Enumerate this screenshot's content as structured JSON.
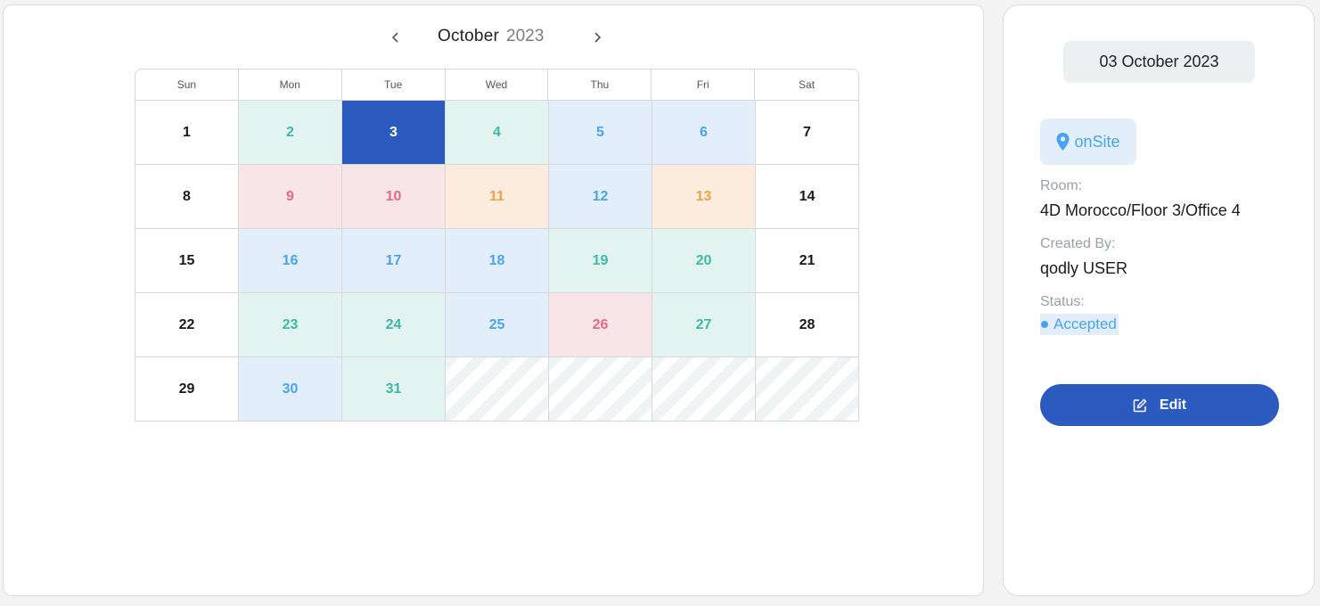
{
  "calendar": {
    "month": "October",
    "year": "2023",
    "weekdays": [
      "Sun",
      "Mon",
      "Tue",
      "Wed",
      "Thu",
      "Fri",
      "Sat"
    ],
    "days": [
      {
        "label": "1",
        "style": "white"
      },
      {
        "label": "2",
        "style": "green"
      },
      {
        "label": "3",
        "style": "selected"
      },
      {
        "label": "4",
        "style": "green"
      },
      {
        "label": "5",
        "style": "blue"
      },
      {
        "label": "6",
        "style": "blue"
      },
      {
        "label": "7",
        "style": "white"
      },
      {
        "label": "8",
        "style": "white"
      },
      {
        "label": "9",
        "style": "pink"
      },
      {
        "label": "10",
        "style": "pink"
      },
      {
        "label": "11",
        "style": "orange"
      },
      {
        "label": "12",
        "style": "blue"
      },
      {
        "label": "13",
        "style": "orange"
      },
      {
        "label": "14",
        "style": "white"
      },
      {
        "label": "15",
        "style": "white"
      },
      {
        "label": "16",
        "style": "blue"
      },
      {
        "label": "17",
        "style": "blue"
      },
      {
        "label": "18",
        "style": "blue"
      },
      {
        "label": "19",
        "style": "green"
      },
      {
        "label": "20",
        "style": "green"
      },
      {
        "label": "21",
        "style": "white"
      },
      {
        "label": "22",
        "style": "white"
      },
      {
        "label": "23",
        "style": "green"
      },
      {
        "label": "24",
        "style": "green"
      },
      {
        "label": "25",
        "style": "blue"
      },
      {
        "label": "26",
        "style": "pink"
      },
      {
        "label": "27",
        "style": "green"
      },
      {
        "label": "28",
        "style": "white"
      },
      {
        "label": "29",
        "style": "white"
      },
      {
        "label": "30",
        "style": "blue"
      },
      {
        "label": "31",
        "style": "green"
      },
      {
        "label": "",
        "style": "empty"
      },
      {
        "label": "",
        "style": "empty"
      },
      {
        "label": "",
        "style": "empty"
      },
      {
        "label": "",
        "style": "empty"
      }
    ]
  },
  "detail": {
    "date": "03 October 2023",
    "type_label": "onSite",
    "type_icon": "map-pin-icon",
    "room_label": "Room:",
    "room_value": "4D Morocco/Floor 3/Office 4",
    "created_by_label": "Created By:",
    "created_by_value": "qodly USER",
    "status_label": "Status:",
    "status_value": "Accepted",
    "edit_label": "Edit",
    "edit_icon": "edit-icon"
  },
  "colors": {
    "accent": "#2c5bbf",
    "green_bg": "#e2f3f0",
    "green_text": "#3dbaa8",
    "blue_bg": "#e3eefb",
    "blue_text": "#4aa3ee",
    "pink_bg": "#f8e5e8",
    "pink_text": "#e56a80",
    "orange_bg": "#fbecdd",
    "orange_text": "#f0a046"
  }
}
